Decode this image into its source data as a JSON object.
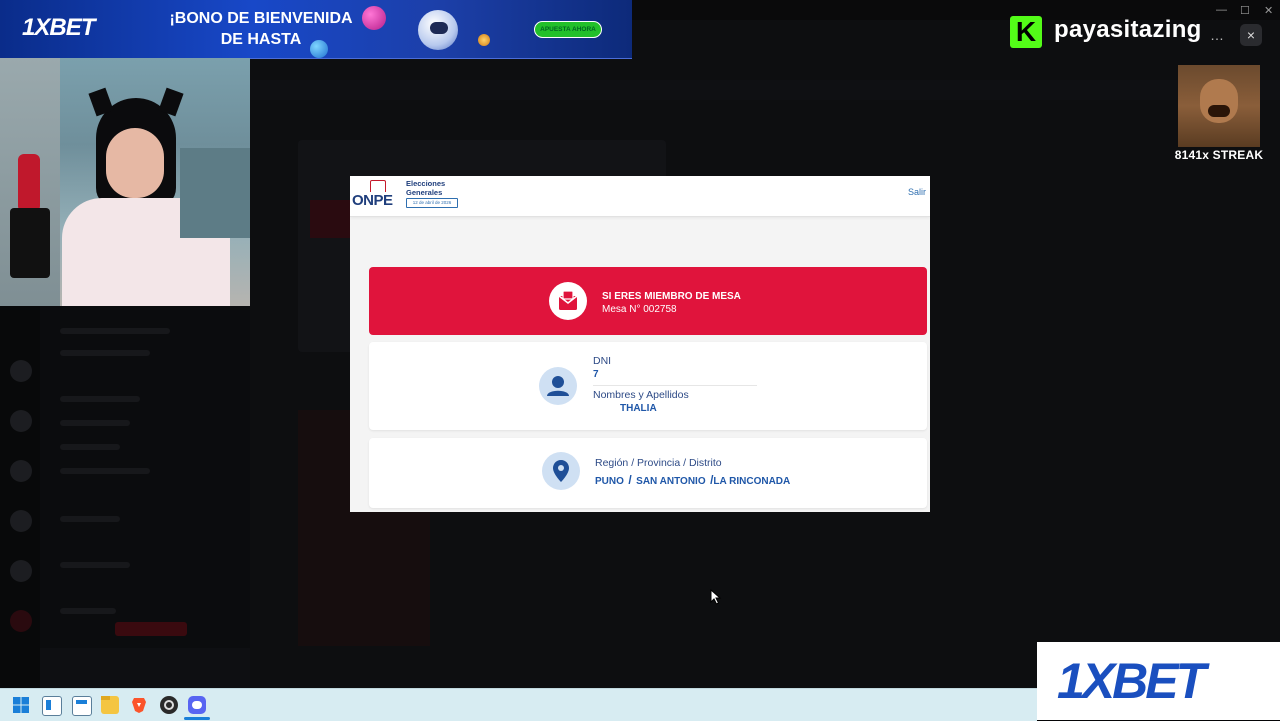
{
  "ad_top": {
    "logo": "1XBET",
    "headline_line1": "¡BONO DE BIENVENIDA",
    "headline_line2": "DE HASTA",
    "cta": "APUESTA AHORA"
  },
  "overlay": {
    "channel_name": "payasitazing",
    "kick_letter": "K",
    "more_glyph": "…",
    "close_glyph": "×",
    "streak_text": "8141x STREAK"
  },
  "window_controls": {
    "minimize": "—",
    "maximize": "☐",
    "close": "✕"
  },
  "onpe_modal": {
    "logo": "ONPE",
    "election_title_line1": "Elecciones",
    "election_title_line2": "Generales",
    "election_date": "12 de abril de 2026",
    "logout_link": "Salir",
    "mesa_card": {
      "title": "SI ERES MIEMBRO DE MESA",
      "mesa_number": "Mesa N° 002758"
    },
    "identity_card": {
      "dni_label": "DNI",
      "dni_value": "7",
      "name_label": "Nombres y Apellidos",
      "name_value": "THALIA"
    },
    "location_card": {
      "label": "Región / Provincia / Distrito",
      "region": "PUNO",
      "province": "SAN ANTONIO",
      "district": "LA RINCONADA",
      "separator": "/"
    }
  },
  "ad_bottom": {
    "logo": "1XBET"
  },
  "taskbar": {
    "icons": [
      "windows-start-icon",
      "window-1-icon",
      "window-2-icon",
      "file-explorer-icon",
      "brave-browser-icon",
      "obs-icon",
      "discord-icon"
    ]
  },
  "colors": {
    "onpe_blue": "#1f3e7c",
    "onpe_red": "#e0143c",
    "kick_green": "#53fc18",
    "xbet_blue": "#1a4fbf"
  }
}
